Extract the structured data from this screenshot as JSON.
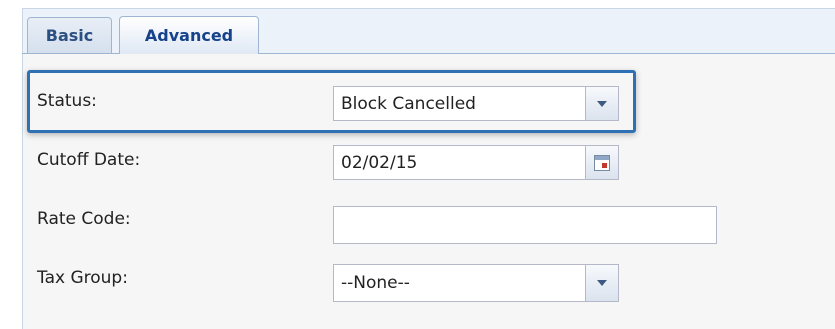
{
  "tabs": [
    {
      "label": "Basic",
      "active": false
    },
    {
      "label": "Advanced",
      "active": true
    }
  ],
  "form": {
    "status": {
      "label": "Status:",
      "value": "Block Cancelled"
    },
    "cutoff_date": {
      "label": "Cutoff Date:",
      "value": "02/02/15"
    },
    "rate_code": {
      "label": "Rate Code:",
      "value": ""
    },
    "tax_group": {
      "label": "Tax Group:",
      "value": "--None--"
    }
  },
  "colors": {
    "highlight_border": "#2f6fb3",
    "tab_text": "#15428b",
    "panel_bg": "#f6f6f6"
  },
  "icons": {
    "dropdown": "chevron-down-icon",
    "calendar": "calendar-icon"
  }
}
